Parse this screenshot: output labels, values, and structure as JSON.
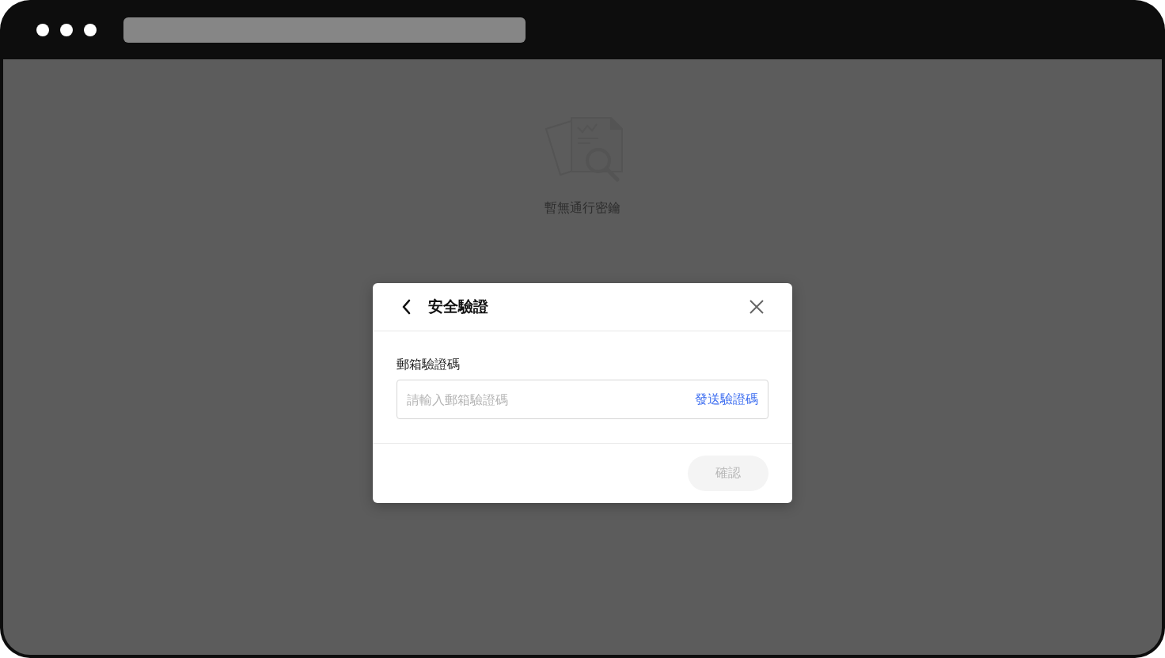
{
  "empty_state": {
    "message": "暫無通行密鑰"
  },
  "dialog": {
    "title": "安全驗證",
    "field": {
      "label": "郵箱驗證碼",
      "placeholder": "請輸入郵箱驗證碼",
      "action": "發送驗證碼"
    },
    "confirm_button": {
      "label": "確認",
      "disabled": true
    }
  }
}
